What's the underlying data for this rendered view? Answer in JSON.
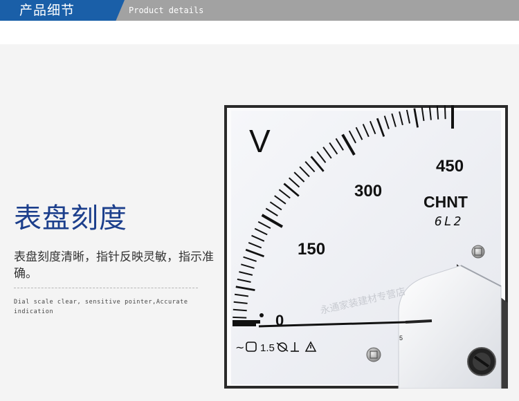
{
  "header": {
    "title_cn": "产品细节",
    "title_en": "Product details"
  },
  "feature": {
    "title": "表盘刻度",
    "description_cn": "表盘刻度清晰，指针反映灵敏，指示准确。",
    "description_en": "Dial scale clear, sensitive pointer,Accurate indication"
  },
  "meter": {
    "unit": "V",
    "scale_labels": [
      "0",
      "150",
      "300",
      "450"
    ],
    "scale_min": 0,
    "scale_max": 450,
    "pointer_value": 0,
    "brand": "CHNT",
    "model": "6L2",
    "spec_accuracy": "1.5",
    "small_mark": "5",
    "watermark": "永通家装建材专营店",
    "colors": {
      "dial": "#f3f4f7",
      "ink": "#111111",
      "frame": "#2a2a2a"
    }
  }
}
